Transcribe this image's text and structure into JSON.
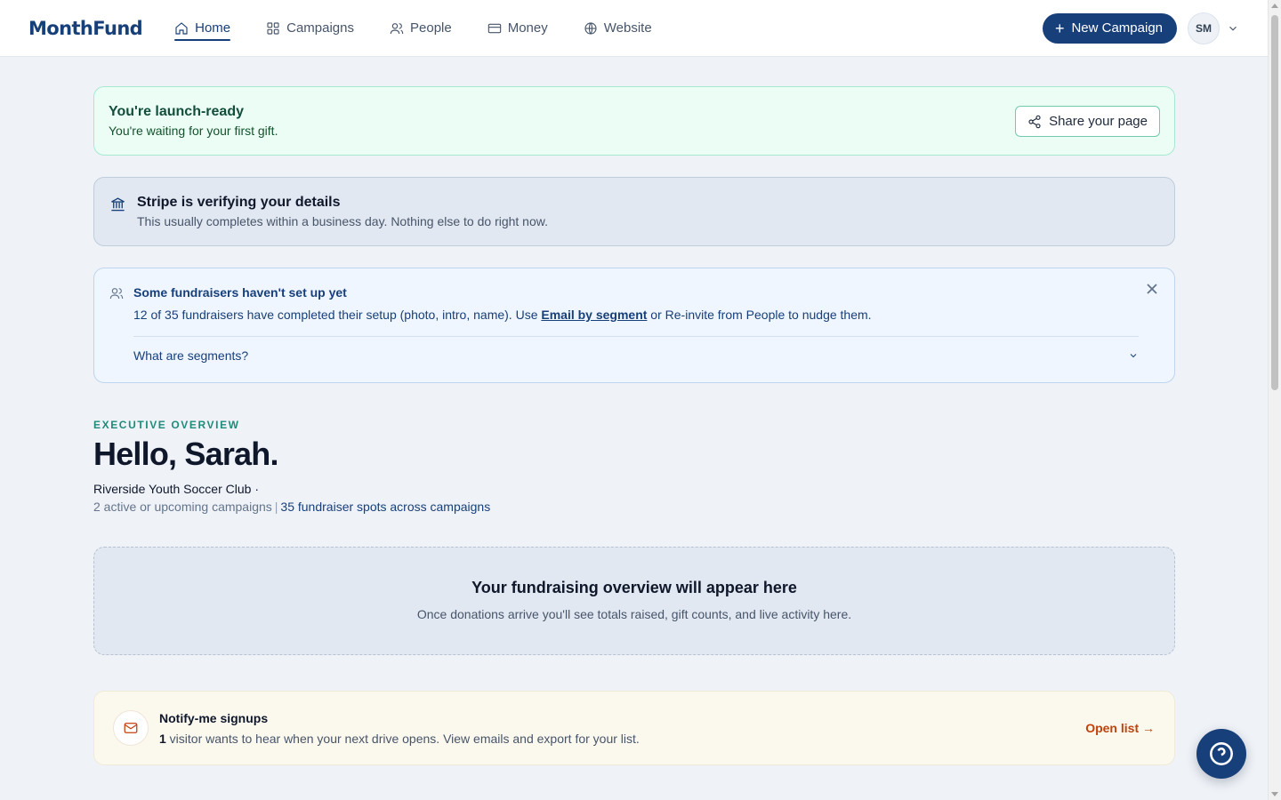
{
  "header": {
    "logo": "MonthFund",
    "nav": [
      {
        "label": "Home",
        "icon": "home-icon",
        "active": true
      },
      {
        "label": "Campaigns",
        "icon": "grid-icon"
      },
      {
        "label": "People",
        "icon": "users-icon"
      },
      {
        "label": "Money",
        "icon": "card-icon"
      },
      {
        "label": "Website",
        "icon": "globe-icon"
      }
    ],
    "new_campaign_label": "New Campaign",
    "avatar_initials": "SM"
  },
  "launch_banner": {
    "title": "You're launch-ready",
    "message": "You're waiting for your first gift.",
    "share_label": "Share your page"
  },
  "stripe_banner": {
    "title": "Stripe is verifying your details",
    "message": "This usually completes within a business day. Nothing else to do right now."
  },
  "fundraisers_banner": {
    "title": "Some fundraisers haven't set up yet",
    "message_prefix": "12 of 35 fundraisers have completed their setup (photo, intro, name). Use ",
    "link_label": "Email by segment",
    "message_suffix": " or Re-invite from People to nudge them.",
    "accordion_label": "What are segments?"
  },
  "overview": {
    "eyebrow": "EXECUTIVE OVERVIEW",
    "greeting": "Hello, Sarah.",
    "org_name": "Riverside Youth Soccer Club ·",
    "campaigns_text": "2 active or upcoming campaigns",
    "separator": "|",
    "fundraiser_spots": "35 fundraiser spots across campaigns"
  },
  "empty_state": {
    "title": "Your fundraising overview will appear here",
    "message": "Once donations arrive you'll see totals raised, gift counts, and live activity here."
  },
  "notify": {
    "title": "Notify-me signups",
    "count": "1",
    "message": " visitor wants to hear when your next drive opens. View emails and export for your list.",
    "open_label": "Open list →"
  },
  "colors": {
    "brand": "#173f7a",
    "launch_bg": "#ecfdf5",
    "accent_orange": "#c2410c",
    "eyebrow_teal": "#1f8b7a"
  }
}
